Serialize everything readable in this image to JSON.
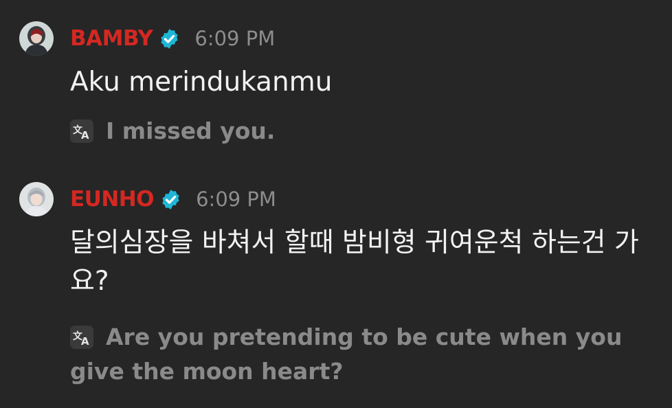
{
  "messages": [
    {
      "username": "BAMBY",
      "username_color": "#d42822",
      "verified_icon": "verified-check-icon",
      "timestamp": "6:09 PM",
      "text": "Aku merindukanmu",
      "translation_icon": "translate-icon",
      "translation": "I missed you."
    },
    {
      "username": "EUNHO",
      "username_color": "#d42822",
      "verified_icon": "verified-check-icon",
      "timestamp": "6:09 PM",
      "text": "달의심장을 바쳐서 할때 밤비형 귀여운척 하는건 가요?",
      "translation_icon": "translate-icon",
      "translation": "Are you pretending to be cute when you give the moon heart?"
    }
  ]
}
